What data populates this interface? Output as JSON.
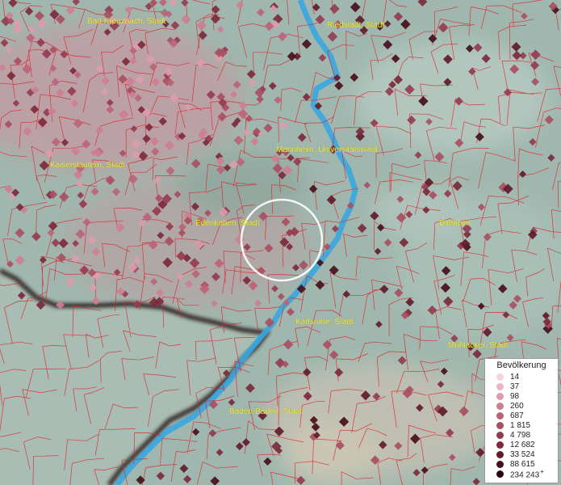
{
  "map": {
    "cities": [
      {
        "name": "Bad Kreuznach, Stadt"
      },
      {
        "name": "Riedstadt, Stadt"
      },
      {
        "name": "Mannheim, Universitätsstadt"
      },
      {
        "name": "Kaiserslautern, Stadt"
      },
      {
        "name": "Edenkoben, Stadt"
      },
      {
        "name": "Dielheim"
      },
      {
        "name": "Karlsruhe, Stadt"
      },
      {
        "name": "Mühlacker, Stadt"
      },
      {
        "name": "Baden-Baden, Stadt"
      }
    ],
    "selection_marker": "circle-highlight",
    "colors": {
      "terrain": "#9fb7ae",
      "foreign_area": "#a9bdb4",
      "river": "#3aa6e0",
      "boundaries": "#e0202a",
      "label": "#f2ee3a"
    }
  },
  "legend": {
    "title": "Bevölkerung",
    "items": [
      {
        "label": "14",
        "color": "#f3d3dc"
      },
      {
        "label": "37",
        "color": "#e8b7c4"
      },
      {
        "label": "98",
        "color": "#dc9cad"
      },
      {
        "label": "260",
        "color": "#cd7f92"
      },
      {
        "label": "687",
        "color": "#bb6478"
      },
      {
        "label": "1 815",
        "color": "#a84f62"
      },
      {
        "label": "4 798",
        "color": "#943c4f"
      },
      {
        "label": "12 682",
        "color": "#7c2a3b"
      },
      {
        "label": "33 524",
        "color": "#621b2b"
      },
      {
        "label": "88 615",
        "color": "#46101c"
      },
      {
        "label": "234 243",
        "color": "#2a0810"
      }
    ],
    "last_suffix": "+"
  }
}
